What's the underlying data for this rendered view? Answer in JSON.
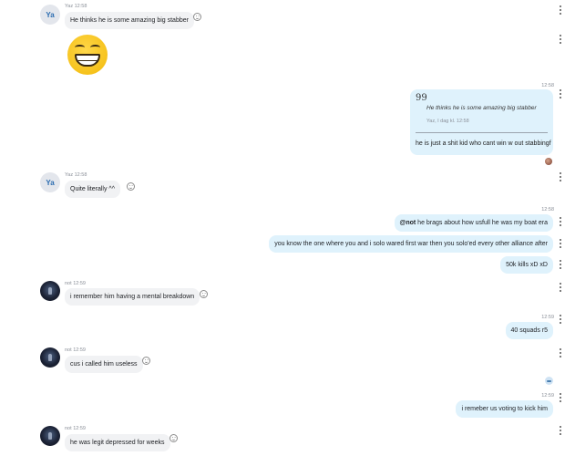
{
  "messages": {
    "m1": {
      "avatar": "Ya",
      "sender": "Yaz",
      "time": "12:58",
      "text": "He thinks he is some amazing big stabber"
    },
    "m2": {
      "emoji": "grinning-face"
    },
    "m3": {
      "time": "12:58",
      "quote_icon": "99",
      "quote_text": "He thinks he is some amazing big stabber",
      "quote_meta": "Yaz, I dag kl. 12:58",
      "reply_text": "he is just a shit kid who cant win w out stabbingf"
    },
    "m4": {
      "avatar": "Ya",
      "sender": "Yaz",
      "time": "12:58",
      "text": "Quite literally ^^"
    },
    "m5": {
      "time": "12:58",
      "mention": "@not",
      "text1": " he brags about how usfull he was my boat era",
      "text2": "you know the one where you and i solo wared first war then you solo'ed every other alliance after",
      "text3": "50k kills xD xD"
    },
    "m6": {
      "sender": "not",
      "time": "12:59",
      "text": "i remember him having a mental breakdown"
    },
    "m7": {
      "time": "12:59",
      "text": "40 squads r5"
    },
    "m8": {
      "sender": "not",
      "time": "12:59",
      "text": "cus i called him useless"
    },
    "m9": {
      "time": "12:59",
      "text": "i remeber us voting to kick him"
    },
    "m10": {
      "sender": "not",
      "time": "12:59",
      "text": "he was legit depressed for weeks"
    }
  },
  "colors": {
    "outgoing_bubble": "#dff2fc",
    "incoming_bubble": "#f1f2f4",
    "timestamp": "#8a8f98"
  }
}
